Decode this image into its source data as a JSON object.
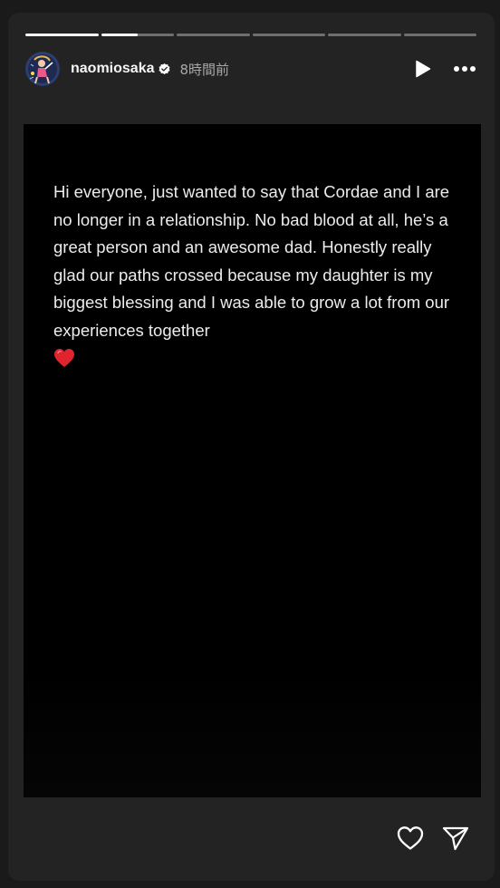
{
  "progress": {
    "segments": [
      1,
      0.5,
      0,
      0,
      0,
      0
    ]
  },
  "header": {
    "username": "naomiosaka",
    "timestamp": "8時間前",
    "avatar_icon": "avatar-illustration",
    "verified_icon": "verified-badge-icon",
    "play_icon": "play-icon",
    "more_icon": "more-icon"
  },
  "story": {
    "text": "Hi everyone, just wanted to say that Cordae and I are no longer in a relationship. No bad blood at all, he’s a great person and an awesome dad. Honestly really glad our paths crossed because my daughter is my biggest blessing and I was able to grow a lot from our experiences together",
    "emoji_icon": "red-heart-emoji",
    "emoji_color": "#e0242f"
  },
  "footer": {
    "like_icon": "heart-icon",
    "share_icon": "send-icon"
  },
  "colors": {
    "background": "#1a1a1a",
    "frame": "#232323",
    "story_bg": "#000000",
    "text": "#ececec"
  }
}
